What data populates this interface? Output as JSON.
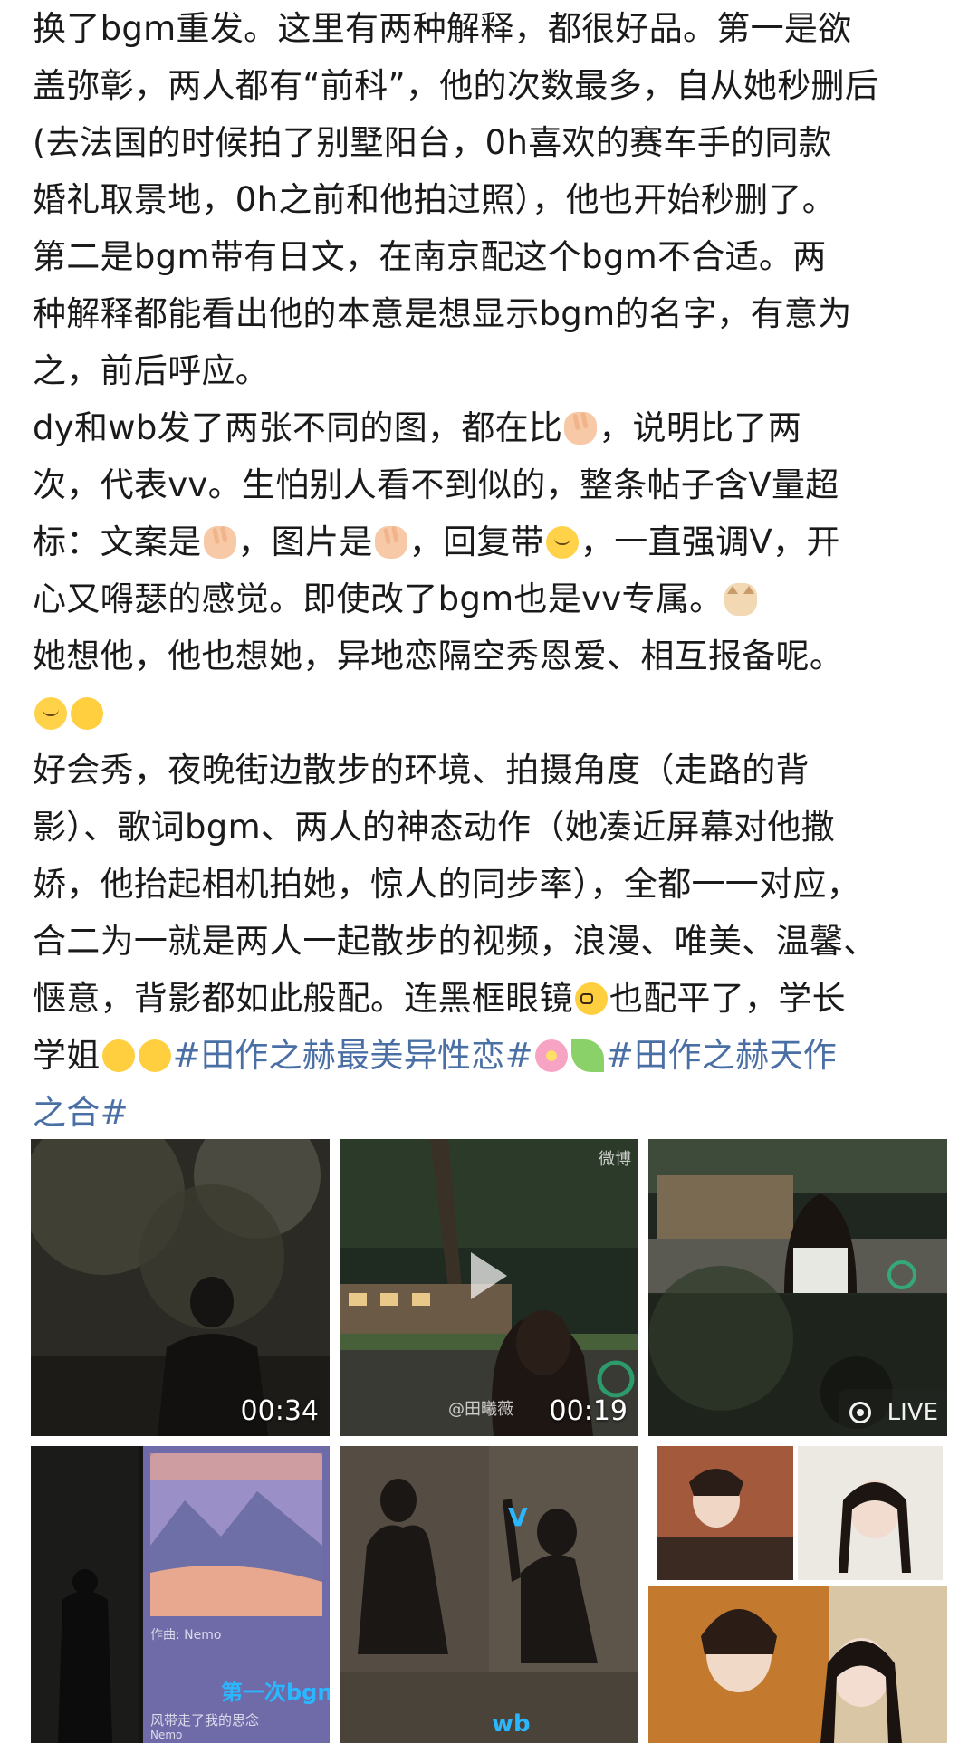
{
  "post": {
    "lines": [
      "换了bgm重发。这里有两种解释，都很好品。第一是欲",
      "盖弥彰，两人都有“前科”，他的次数最多，自从她秒删后",
      "(去法国的时候拍了别墅阳台，0h喜欢的赛车手的同款",
      "婚礼取景地，0h之前和他拍过照），他也开始秒删了。",
      "第二是bgm带有日文，在南京配这个bgm不合适。两",
      "种解释都能看出他的本意是想显示bgm的名字，有意为",
      "之，前后呼应。"
    ],
    "p2": {
      "l1a": "dy和wb发了两张不同的图，都在比",
      "l1b": "，说明比了两",
      "l2": "次，代表vv。生怕别人看不到似的，整条帖子含V量超",
      "l3a": "标：文案是",
      "l3b": "，图片是",
      "l3c": "，回复带",
      "l3d": "，一直强调V，开",
      "l4a": "心又嘚瑟的感觉。即使改了bgm也是vv专属。"
    },
    "p3": "她想他，他也想她，异地恋隔空秀恩爱、相互报备呢。",
    "p4": {
      "l1": "好会秀，夜晚街边散步的环境、拍摄角度（走路的背",
      "l2": "影）、歌词bgm、两人的神态动作（她凑近屏幕对他撒",
      "l3": "娇，他抬起相机拍她，惊人的同步率），全都一一对应，",
      "l4": "合二为一就是两人一起散步的视频，浪漫、唯美、温馨、",
      "l5a": "惬意，背影都如此般配。连黑框眼镜",
      "l5b": "也配平了，学长",
      "l6a": "学姐",
      "tag1": "#田作之赫最美异性恋#",
      "tag2a": "#田作之赫天作",
      "tag2b": "之合#"
    }
  },
  "media": {
    "video1": {
      "duration": "00:34"
    },
    "video2": {
      "duration": "00:19",
      "watermark": "@田曦薇",
      "corner_mark": "微博"
    },
    "live_badge": "LIVE",
    "shot4": {
      "caption": "第一次bgn",
      "song": "风带走了我的思念",
      "meta": "作曲: Nemo",
      "footer": "Nemo"
    },
    "shot5": {
      "top_label": "V",
      "bottom_label": "wb"
    }
  },
  "emoji": {
    "peace": "victory-hand",
    "face": "smiling-face-with-heart-eyes",
    "cat": "cat-face",
    "relieved": "relieved-face",
    "hug": "hugging-face",
    "glasses": "nerd-face",
    "pleading": "pleading-face",
    "flower": "cherry-blossom",
    "leaf": "leaf"
  },
  "colors": {
    "text": "#1a1a1a",
    "hashtag": "#4a6fa5",
    "background": "#ffffff"
  }
}
